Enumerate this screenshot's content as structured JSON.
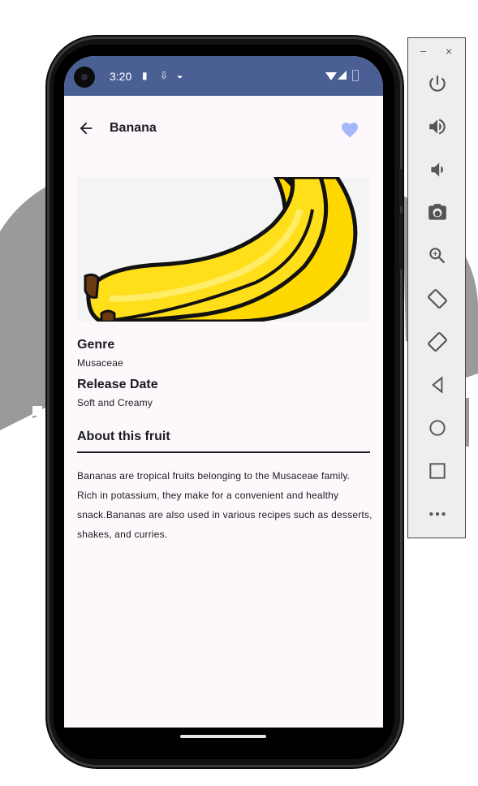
{
  "status_bar": {
    "time": "3:20",
    "background": "#4a5f94"
  },
  "app_bar": {
    "title": "Banana",
    "favorite_color": "#a7b6f7"
  },
  "fruit": {
    "genre_label": "Genre",
    "genre_value": "Musaceae",
    "release_label": "Release Date",
    "release_value": "Soft and Creamy",
    "about_title": "About this fruit",
    "about_text": "Bananas are tropical fruits belonging to the Musaceae family. Rich in potassium, they make for a convenient and healthy snack.Bananas are also used in various recipes such as desserts, shakes, and curries."
  },
  "emulator_controls": {
    "minimize_label": "–",
    "close_label": "×",
    "buttons": [
      "power-icon",
      "volume-up-icon",
      "volume-down-icon",
      "camera-icon",
      "zoom-icon",
      "rotate-left-icon",
      "rotate-right-icon",
      "back-icon",
      "home-icon",
      "overview-icon",
      "more-icon"
    ]
  }
}
